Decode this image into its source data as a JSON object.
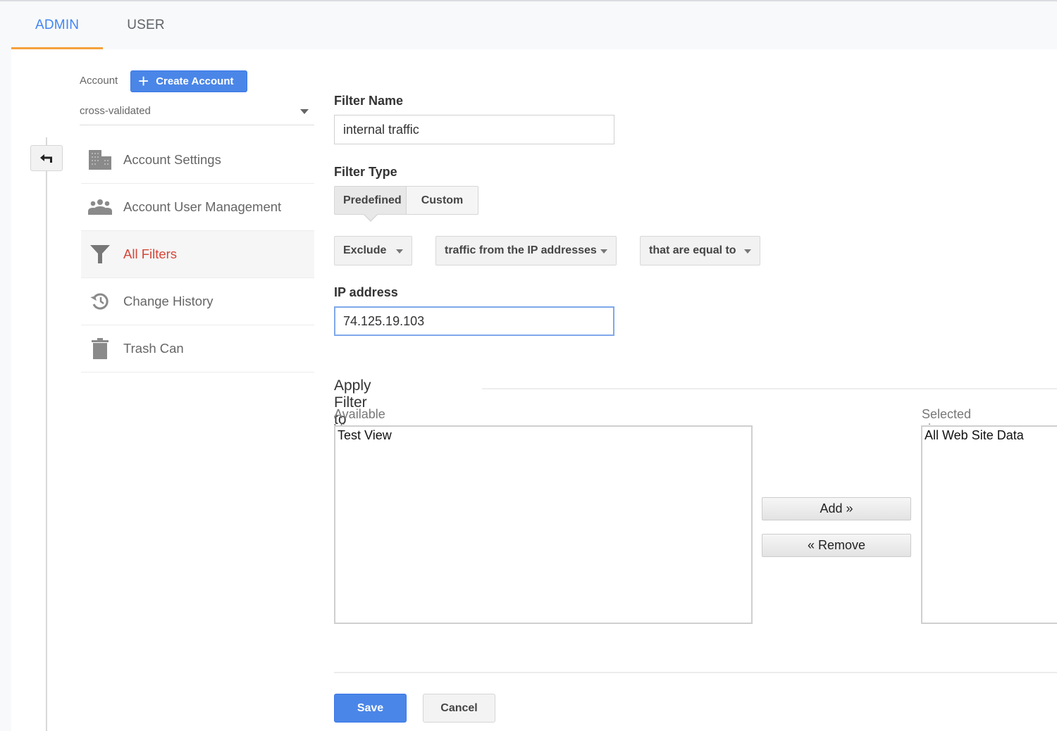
{
  "tabs": [
    {
      "label": "ADMIN",
      "active": true
    },
    {
      "label": "USER",
      "active": false
    }
  ],
  "account": {
    "label": "Account",
    "create_button": "Create Account",
    "selected": "cross-validated"
  },
  "sidebar": {
    "back_icon": "back-arrow-icon",
    "items": [
      {
        "label": "Account Settings",
        "icon": "building-icon",
        "active": false
      },
      {
        "label": "Account User Management",
        "icon": "people-icon",
        "active": false
      },
      {
        "label": "All Filters",
        "icon": "filter-icon",
        "active": true
      },
      {
        "label": "Change History",
        "icon": "history-icon",
        "active": false
      },
      {
        "label": "Trash Can",
        "icon": "trash-icon",
        "active": false
      }
    ]
  },
  "form": {
    "filter_name_label": "Filter Name",
    "filter_name_value": "internal traffic",
    "filter_type_label": "Filter Type",
    "filter_type_options": [
      "Predefined",
      "Custom"
    ],
    "filter_type_selected": "Predefined",
    "action_select": "Exclude",
    "source_select": "traffic from the IP addresses",
    "condition_select": "that are equal to",
    "ip_label": "IP address",
    "ip_value": "74.125.19.103"
  },
  "views": {
    "section_title": "Apply Filter to Views",
    "available_label": "Available Views",
    "available": [
      "Test View"
    ],
    "selected_label": "Selected views",
    "selected": [
      "All Web Site Data"
    ],
    "add_button": "Add »",
    "remove_button": "« Remove"
  },
  "actions": {
    "save": "Save",
    "cancel": "Cancel"
  },
  "colors": {
    "accent_blue": "#4a86e8",
    "tab_active": "#4285f4",
    "tab_underline": "#f4a13c",
    "nav_active": "#d44638"
  }
}
